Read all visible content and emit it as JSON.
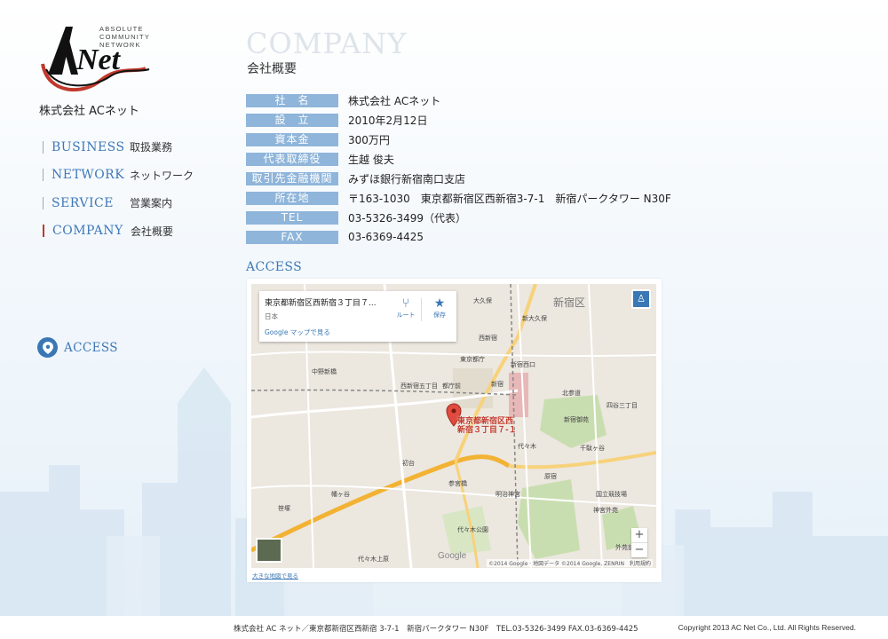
{
  "brand": {
    "logo_text": "Net",
    "logo_sub": [
      "ABSOLUTE",
      "COMMUNITY",
      "NETWORK"
    ],
    "company_name": "株式会社 ACネット",
    "accent_red": "#c0392b",
    "accent_blue": "#3f78b6",
    "label_blue": "#8fb5da"
  },
  "nav": {
    "items": [
      {
        "en": "BUSINESS",
        "ja": "取扱業務"
      },
      {
        "en": "NETWORK",
        "ja": "ネットワーク"
      },
      {
        "en": "SERVICE",
        "ja": "営業案内"
      },
      {
        "en": "COMPANY",
        "ja": "会社概要"
      }
    ],
    "active": "COMPANY",
    "access_label": "ACCESS",
    "access_icon": "map-pin-icon"
  },
  "page": {
    "title_en": "COMPANY",
    "title_ja": "会社概要"
  },
  "info": [
    {
      "label": "社　名",
      "value": "株式会社 ACネット"
    },
    {
      "label": "設　立",
      "value": "2010年2月12日"
    },
    {
      "label": "資本金",
      "value": "300万円"
    },
    {
      "label": "代表取締役",
      "value": "生越 俊夫"
    },
    {
      "label": "取引先金融機関",
      "value": "みずほ銀行新宿南口支店"
    },
    {
      "label": "所在地",
      "value": "〒163-1030　東京都新宿区西新宿3-7-1　新宿パークタワー N30F"
    },
    {
      "label": "TEL",
      "value": "03-5326-3499（代表）"
    },
    {
      "label": "FAX",
      "value": "03-6369-4425"
    }
  ],
  "access": {
    "title": "ACCESS",
    "map": {
      "card_address": "東京都新宿区西新宿３丁目７...",
      "card_country": "日本",
      "card_route": "ルート",
      "card_save": "保存",
      "card_gmap_link": "Google マップで見る",
      "pin_label_1": "東京都新宿区西",
      "pin_label_2": "新宿３丁目７-１",
      "zoom_in": "+",
      "zoom_out": "−",
      "google_logo": "Google",
      "copyright": "©2014 Google · 地図データ ©2014 Google, ZENRIN　利用規約",
      "large_map_link": "大きな地図で見る",
      "labels": [
        "新宿区",
        "大久保",
        "新大久保",
        "西新宿",
        "新宿西口",
        "新宿",
        "代々木",
        "初台",
        "参宮橋",
        "代々木公園",
        "明治神宮",
        "東京都庁",
        "中野新橋",
        "西新宿五丁目",
        "都庁前",
        "北参道",
        "千駄ヶ谷",
        "四谷三丁目",
        "新宿御苑",
        "幡ヶ谷",
        "笹塚",
        "代々木上原",
        "原宿",
        "外苑前",
        "国立競技場",
        "神宮外苑"
      ]
    }
  },
  "footer": {
    "address": "株式会社 AC ネット／東京都新宿区西新宿 3-7-1　新宿パークタワー N30F　TEL.03-5326-3499 FAX.03-6369-4425",
    "copyright": "Copyright 2013 AC Net Co., Ltd. All Rights Reserved."
  }
}
